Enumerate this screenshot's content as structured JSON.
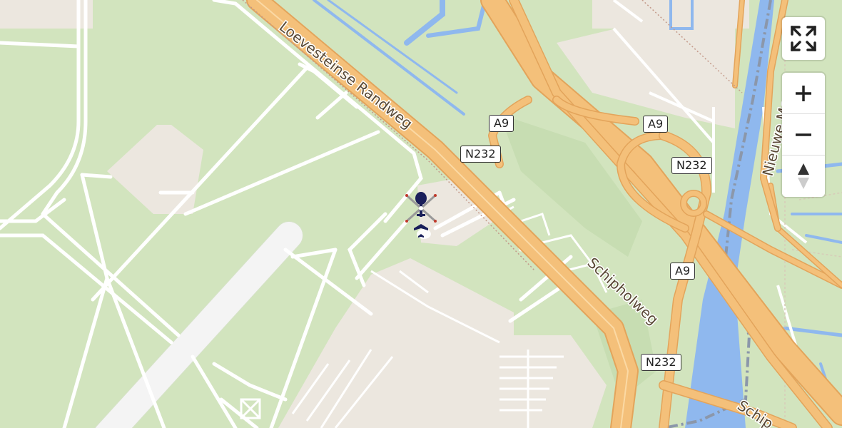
{
  "map": {
    "colors": {
      "background": "#d2e4be",
      "water": "#8fb8ee",
      "motorway": "#f4c07a",
      "motorway_casing": "#e3a45b",
      "apron": "#ece7df",
      "road": "#ffffff",
      "rail": "#9aa3ad"
    },
    "road_labels": [
      {
        "id": "loevesteinse",
        "text": "Loevesteinse Randweg"
      },
      {
        "id": "schipholweg",
        "text": "Schipholweg"
      },
      {
        "id": "nieuwe-meer",
        "text": "Nieuwe Meer"
      },
      {
        "id": "schip-bottom",
        "text": "Schip"
      }
    ],
    "shields": [
      {
        "id": "a9-1",
        "text": "A9"
      },
      {
        "id": "a9-2",
        "text": "A9"
      },
      {
        "id": "a9-3",
        "text": "A9"
      },
      {
        "id": "n232-1",
        "text": "N232"
      },
      {
        "id": "n232-2",
        "text": "N232"
      },
      {
        "id": "n232-3",
        "text": "N232"
      }
    ],
    "marker": {
      "icon": "helicopter-icon",
      "secondary_icon": "airplane-icon"
    }
  },
  "controls": {
    "fullscreen_icon": "fullscreen-icon",
    "zoom_in_icon": "plus-icon",
    "zoom_out_icon": "minus-icon",
    "compass_icon": "compass-icon"
  }
}
